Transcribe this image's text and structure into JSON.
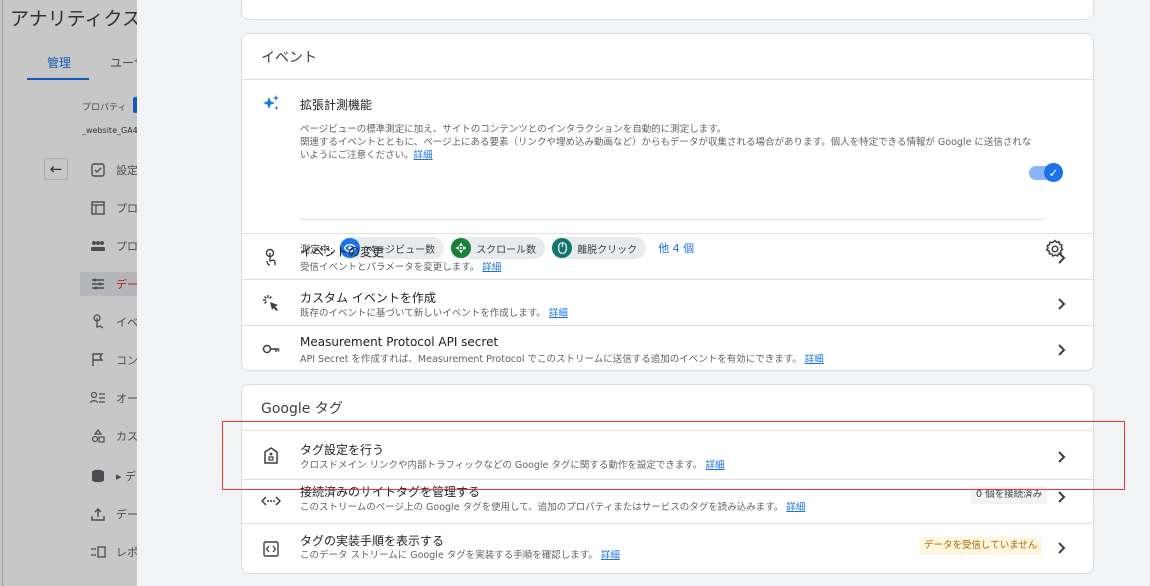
{
  "background": {
    "app_title": "アナリティクス",
    "tabs": [
      {
        "label": "管理"
      },
      {
        "label": "ユーザ"
      }
    ],
    "property_label": "プロパティ",
    "property_name": "_website_GA4",
    "nav_items": [
      {
        "icon": "checkbox-icon",
        "label": "設定"
      },
      {
        "icon": "window-icon",
        "label": "プロ"
      },
      {
        "icon": "group-icon",
        "label": "プロ"
      },
      {
        "icon": "data-stream-icon",
        "label": "デー"
      },
      {
        "icon": "touch-icon",
        "label": "イベ"
      },
      {
        "icon": "flag-icon",
        "label": "コン"
      },
      {
        "icon": "audience-icon",
        "label": "オー"
      },
      {
        "icon": "shapes-icon",
        "label": "カス"
      },
      {
        "icon": "database-icon",
        "label": "▸ デ"
      },
      {
        "icon": "upload-icon",
        "label": "デー"
      },
      {
        "icon": "report-icon",
        "label": "レポ"
      }
    ]
  },
  "events_card": {
    "header": "イベント",
    "enhanced": {
      "icon": "sparkle-icon",
      "title": "拡張計測機能",
      "desc_1": "ページビューの標準測定に加え、サイトのコンテンツとのインタラクションを自動的に測定します。",
      "desc_2": "関連するイベントとともに、ページ上にある要素（リンクや埋め込み動画など）からもデータが収集される場合があります。個人を特定できる情報が Google に送信されないようにご注意ください。",
      "desc_link": "詳細",
      "toggle_on": true,
      "measuring_label": "測定中:",
      "chips": [
        {
          "icon": "eye-icon",
          "label": "ページビュー数",
          "color": "#1a73e8"
        },
        {
          "icon": "compass-icon",
          "label": "スクロール数",
          "color": "#188038"
        },
        {
          "icon": "mouse-icon",
          "label": "離脱クリック",
          "color": "#12766f"
        }
      ],
      "more": "他 4 個"
    },
    "rows": [
      {
        "icon": "touch-app-icon",
        "title": "イベントの変更",
        "desc": "受信イベントとパラメータを変更します。",
        "link": "詳細"
      },
      {
        "icon": "ads-click-icon",
        "title": "カスタム イベントを作成",
        "desc": "既存のイベントに基づいて新しいイベントを作成します。",
        "link": "詳細"
      },
      {
        "icon": "key-icon",
        "title": "Measurement Protocol API secret",
        "desc": "API Secret を作成すれば、Measurement Protocol でこのストリームに送信する追加のイベントを有効にできます。",
        "link": "詳細"
      }
    ]
  },
  "gtag_card": {
    "header": "Google タグ",
    "rows": [
      {
        "icon": "tag-shield-icon",
        "title": "タグ設定を行う",
        "desc": "クロスドメイン リンクや内部トラフィックなどの Google タグに関する動作を設定できます。",
        "link": "詳細",
        "badge": ""
      },
      {
        "icon": "code-icon",
        "title": "接続済みのサイトタグを管理する",
        "desc": "このストリームのページ上の Google タグを使用して、追加のプロパティまたはサービスのタグを読み込みます。",
        "link": "詳細",
        "badge": "0 個を接続済み"
      },
      {
        "icon": "code-box-icon",
        "title": "タグの実装手順を表示する",
        "desc": "このデータ ストリームに Google タグを実装する手順を確認します。",
        "link": "詳細",
        "badge": "データを受信していません"
      }
    ]
  },
  "colors": {
    "accent": "#1a73e8",
    "highlight": "#e53935",
    "warning": "#b06000"
  }
}
